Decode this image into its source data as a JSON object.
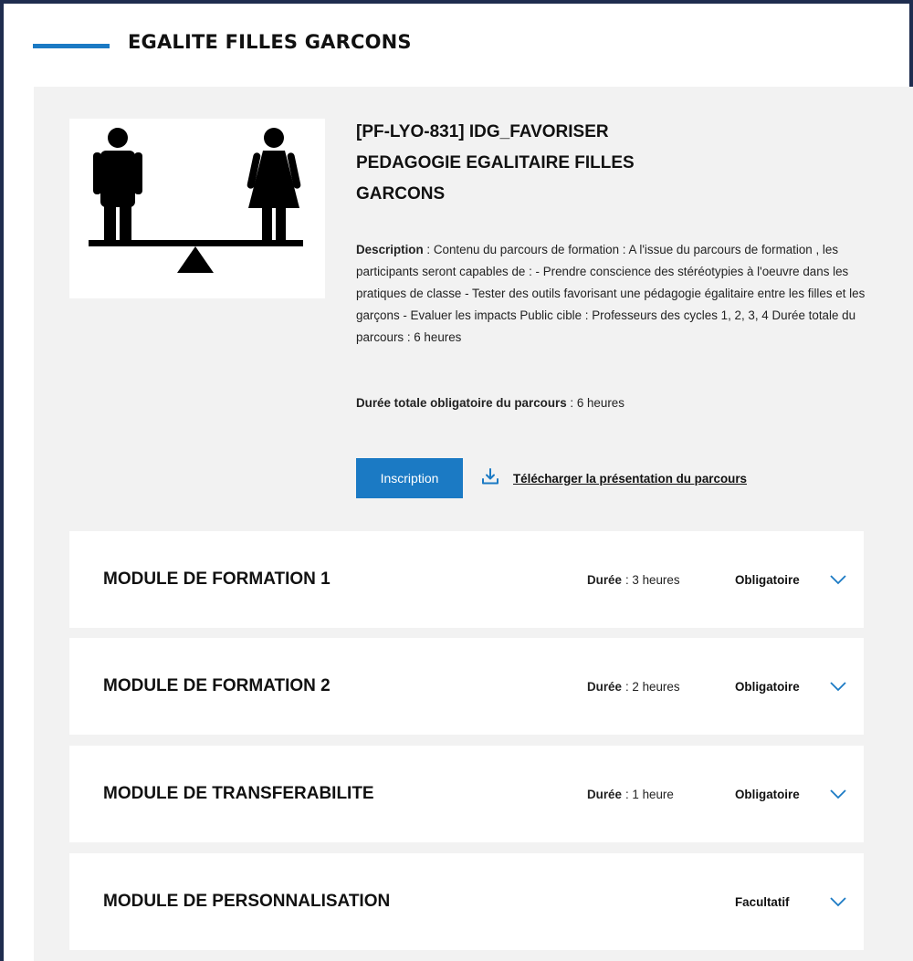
{
  "section": {
    "title": "EGALITE FILLES GARCONS",
    "accent_color": "#1b7ac4"
  },
  "course": {
    "title_line1": "[PF-LYO-831] IDG_FAVORISER",
    "title_line2": "PEDAGOGIE EGALITAIRE FILLES",
    "title_line3": "GARCONS",
    "illustration_icon": "gender-equality-balance-icon",
    "description_label": "Description",
    "description_text": " : Contenu du parcours de formation : A l'issue du parcours de formation , les participants seront capables de : - Prendre conscience des stéréotypies à l'oeuvre dans les pratiques de classe - Tester des outils favorisant une pédagogie égalitaire entre les filles et les garçons - Evaluer les impacts Public cible : Professeurs des cycles 1, 2, 3, 4 Durée totale du parcours : 6 heures",
    "duration_label": "Durée totale obligatoire du parcours",
    "duration_value": " : 6 heures"
  },
  "actions": {
    "inscription_label": "Inscription",
    "download_label": "Télécharger la présentation du parcours",
    "download_icon": "download-icon"
  },
  "modules": [
    {
      "title": "MODULE DE FORMATION 1",
      "duree_label": "Durée",
      "duree_value": ": 3 heures",
      "status": "Obligatoire"
    },
    {
      "title": "MODULE DE FORMATION 2",
      "duree_label": "Durée",
      "duree_value": ": 2 heures",
      "status": "Obligatoire"
    },
    {
      "title": "MODULE DE TRANSFERABILITE",
      "duree_label": "Durée",
      "duree_value": ": 1 heure",
      "status": "Obligatoire"
    },
    {
      "title": "MODULE DE PERSONNALISATION",
      "duree_label": "",
      "duree_value": "",
      "status": "Facultatif"
    }
  ]
}
